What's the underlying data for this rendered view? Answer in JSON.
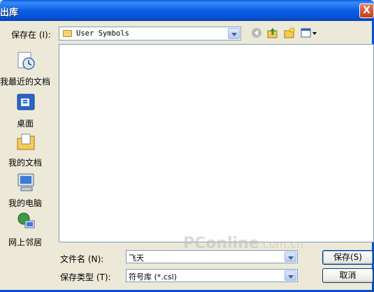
{
  "window": {
    "title": "出库",
    "close_glyph": "X"
  },
  "save_in": {
    "label": "保存在 (I):",
    "value": "User Symbols"
  },
  "toolbar": {
    "back_icon": "back-arrow-icon",
    "up_icon": "up-folder-icon",
    "new_folder_icon": "new-folder-icon",
    "view_icon": "view-menu-icon"
  },
  "places": [
    {
      "label": "我最近的文档",
      "icon": "recent-documents-icon"
    },
    {
      "label": "桌面",
      "icon": "desktop-icon"
    },
    {
      "label": "我的文档",
      "icon": "my-documents-icon"
    },
    {
      "label": "我的电脑",
      "icon": "my-computer-icon"
    },
    {
      "label": "网上邻居",
      "icon": "network-places-icon"
    }
  ],
  "filename": {
    "label": "文件名 (N):",
    "value": "飞天"
  },
  "filetype": {
    "label": "保存类型 (T):",
    "value": "符号库 (*.csl)"
  },
  "buttons": {
    "save": "保存(S)",
    "cancel": "取消"
  },
  "watermark": {
    "main": "PConline",
    "suffix": ".com.cn"
  }
}
